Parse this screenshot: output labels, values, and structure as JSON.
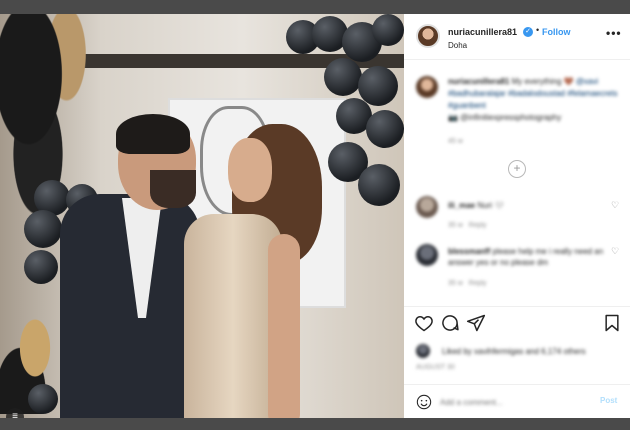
{
  "post": {
    "username": "nuriacunillera81",
    "follow_label": "Follow",
    "separator": "•",
    "location": "Doha",
    "more_label": "•••"
  },
  "caption": {
    "username": "nuriacunillera81",
    "text": "My everything 🤎",
    "tags": "@xavi #badhubaralajar #badalodoustad #felamaecrets #guanbent",
    "credit": "📷 @infinitiexpressphotography",
    "time": "45 w"
  },
  "comments": [
    {
      "username": "ili_mae",
      "text": "Nuri 🤍",
      "time": "35 w",
      "reply": "Reply"
    },
    {
      "username": "blessmanff",
      "text": "please help me i really need an answer yes or no please dm",
      "time": "35 w",
      "reply": "Reply"
    }
  ],
  "likes": {
    "text": "Liked by xavihfermigas and 6,174 others"
  },
  "post_date": "AUGUST 30",
  "add_comment": {
    "placeholder": "Add a comment...",
    "post_label": "Post"
  },
  "icons": {
    "load_more": "+",
    "heart": "♡",
    "verified": "✓",
    "gallery": "≡"
  },
  "colors": {
    "accent": "#3897f0",
    "text": "#262626",
    "muted": "#8e8e8e"
  }
}
